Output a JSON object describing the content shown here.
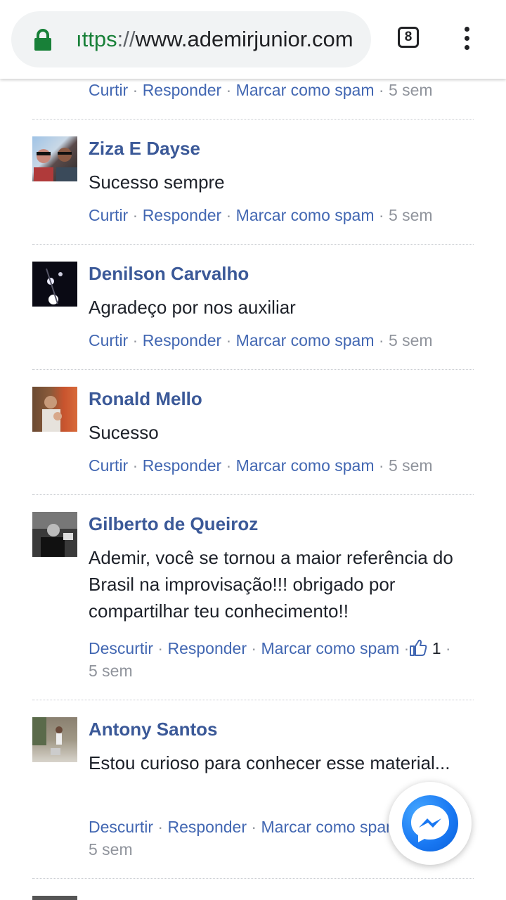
{
  "browser": {
    "url_scheme": "ıttps",
    "url_sep": "://",
    "url_host": "www.ademirjunior.com",
    "tab_count": "8"
  },
  "labels": {
    "like": "Curtir",
    "unlike": "Descurtir",
    "reply": "Responder",
    "spam": "Marcar como spam",
    "dot": "·"
  },
  "top_partial": {
    "time": "5 sem"
  },
  "comments": [
    {
      "name": "Ziza E Dayse",
      "text": "Sucesso sempre",
      "action": "Curtir",
      "time": "5 sem"
    },
    {
      "name": "Denilson Carvalho",
      "text": "Agradeço por nos auxiliar",
      "action": "Curtir",
      "time": "5 sem"
    },
    {
      "name": "Ronald Mello",
      "text": "Sucesso",
      "action": "Curtir",
      "time": "5 sem"
    },
    {
      "name": "Gilberto de Queiroz",
      "text": "Ademir, você se tornou a maior referência do Brasil na improvisação!!! obrigado por compartilhar teu conhecimento!!",
      "action": "Descurtir",
      "likes": "1",
      "time": "5 sem"
    },
    {
      "name": "Antony Santos",
      "text": "Estou curioso para conhecer esse material...",
      "action": "Descurtir",
      "time": "5 sem"
    }
  ],
  "colors": {
    "link": "#4267b2",
    "name": "#3b5998",
    "meta": "#90949c",
    "messenger": "#1877f2"
  },
  "icons": [
    "lock-icon",
    "menu-icon",
    "thumbs-up-icon",
    "messenger-icon"
  ]
}
